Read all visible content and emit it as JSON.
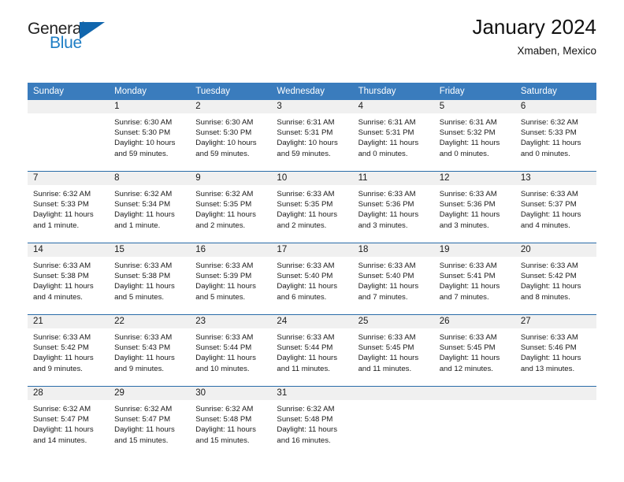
{
  "brand": {
    "name_top": "General",
    "name_bottom": "Blue",
    "accent_color": "#1166ad",
    "text_blue": "#1d7dc4"
  },
  "header": {
    "title": "January 2024",
    "subtitle": "Xmaben, Mexico"
  },
  "theme": {
    "header_bg": "#3a7cbd",
    "row_divider": "#2a6ca8",
    "daynum_bg": "#f0f0f0"
  },
  "weekday_headers": [
    "Sunday",
    "Monday",
    "Tuesday",
    "Wednesday",
    "Thursday",
    "Friday",
    "Saturday"
  ],
  "weeks": [
    [
      {
        "day": "",
        "empty": true
      },
      {
        "day": "1",
        "sunrise": "Sunrise: 6:30 AM",
        "sunset": "Sunset: 5:30 PM",
        "daylight_1": "Daylight: 10 hours",
        "daylight_2": "and 59 minutes."
      },
      {
        "day": "2",
        "sunrise": "Sunrise: 6:30 AM",
        "sunset": "Sunset: 5:30 PM",
        "daylight_1": "Daylight: 10 hours",
        "daylight_2": "and 59 minutes."
      },
      {
        "day": "3",
        "sunrise": "Sunrise: 6:31 AM",
        "sunset": "Sunset: 5:31 PM",
        "daylight_1": "Daylight: 10 hours",
        "daylight_2": "and 59 minutes."
      },
      {
        "day": "4",
        "sunrise": "Sunrise: 6:31 AM",
        "sunset": "Sunset: 5:31 PM",
        "daylight_1": "Daylight: 11 hours",
        "daylight_2": "and 0 minutes."
      },
      {
        "day": "5",
        "sunrise": "Sunrise: 6:31 AM",
        "sunset": "Sunset: 5:32 PM",
        "daylight_1": "Daylight: 11 hours",
        "daylight_2": "and 0 minutes."
      },
      {
        "day": "6",
        "sunrise": "Sunrise: 6:32 AM",
        "sunset": "Sunset: 5:33 PM",
        "daylight_1": "Daylight: 11 hours",
        "daylight_2": "and 0 minutes."
      }
    ],
    [
      {
        "day": "7",
        "sunrise": "Sunrise: 6:32 AM",
        "sunset": "Sunset: 5:33 PM",
        "daylight_1": "Daylight: 11 hours",
        "daylight_2": "and 1 minute."
      },
      {
        "day": "8",
        "sunrise": "Sunrise: 6:32 AM",
        "sunset": "Sunset: 5:34 PM",
        "daylight_1": "Daylight: 11 hours",
        "daylight_2": "and 1 minute."
      },
      {
        "day": "9",
        "sunrise": "Sunrise: 6:32 AM",
        "sunset": "Sunset: 5:35 PM",
        "daylight_1": "Daylight: 11 hours",
        "daylight_2": "and 2 minutes."
      },
      {
        "day": "10",
        "sunrise": "Sunrise: 6:33 AM",
        "sunset": "Sunset: 5:35 PM",
        "daylight_1": "Daylight: 11 hours",
        "daylight_2": "and 2 minutes."
      },
      {
        "day": "11",
        "sunrise": "Sunrise: 6:33 AM",
        "sunset": "Sunset: 5:36 PM",
        "daylight_1": "Daylight: 11 hours",
        "daylight_2": "and 3 minutes."
      },
      {
        "day": "12",
        "sunrise": "Sunrise: 6:33 AM",
        "sunset": "Sunset: 5:36 PM",
        "daylight_1": "Daylight: 11 hours",
        "daylight_2": "and 3 minutes."
      },
      {
        "day": "13",
        "sunrise": "Sunrise: 6:33 AM",
        "sunset": "Sunset: 5:37 PM",
        "daylight_1": "Daylight: 11 hours",
        "daylight_2": "and 4 minutes."
      }
    ],
    [
      {
        "day": "14",
        "sunrise": "Sunrise: 6:33 AM",
        "sunset": "Sunset: 5:38 PM",
        "daylight_1": "Daylight: 11 hours",
        "daylight_2": "and 4 minutes."
      },
      {
        "day": "15",
        "sunrise": "Sunrise: 6:33 AM",
        "sunset": "Sunset: 5:38 PM",
        "daylight_1": "Daylight: 11 hours",
        "daylight_2": "and 5 minutes."
      },
      {
        "day": "16",
        "sunrise": "Sunrise: 6:33 AM",
        "sunset": "Sunset: 5:39 PM",
        "daylight_1": "Daylight: 11 hours",
        "daylight_2": "and 5 minutes."
      },
      {
        "day": "17",
        "sunrise": "Sunrise: 6:33 AM",
        "sunset": "Sunset: 5:40 PM",
        "daylight_1": "Daylight: 11 hours",
        "daylight_2": "and 6 minutes."
      },
      {
        "day": "18",
        "sunrise": "Sunrise: 6:33 AM",
        "sunset": "Sunset: 5:40 PM",
        "daylight_1": "Daylight: 11 hours",
        "daylight_2": "and 7 minutes."
      },
      {
        "day": "19",
        "sunrise": "Sunrise: 6:33 AM",
        "sunset": "Sunset: 5:41 PM",
        "daylight_1": "Daylight: 11 hours",
        "daylight_2": "and 7 minutes."
      },
      {
        "day": "20",
        "sunrise": "Sunrise: 6:33 AM",
        "sunset": "Sunset: 5:42 PM",
        "daylight_1": "Daylight: 11 hours",
        "daylight_2": "and 8 minutes."
      }
    ],
    [
      {
        "day": "21",
        "sunrise": "Sunrise: 6:33 AM",
        "sunset": "Sunset: 5:42 PM",
        "daylight_1": "Daylight: 11 hours",
        "daylight_2": "and 9 minutes."
      },
      {
        "day": "22",
        "sunrise": "Sunrise: 6:33 AM",
        "sunset": "Sunset: 5:43 PM",
        "daylight_1": "Daylight: 11 hours",
        "daylight_2": "and 9 minutes."
      },
      {
        "day": "23",
        "sunrise": "Sunrise: 6:33 AM",
        "sunset": "Sunset: 5:44 PM",
        "daylight_1": "Daylight: 11 hours",
        "daylight_2": "and 10 minutes."
      },
      {
        "day": "24",
        "sunrise": "Sunrise: 6:33 AM",
        "sunset": "Sunset: 5:44 PM",
        "daylight_1": "Daylight: 11 hours",
        "daylight_2": "and 11 minutes."
      },
      {
        "day": "25",
        "sunrise": "Sunrise: 6:33 AM",
        "sunset": "Sunset: 5:45 PM",
        "daylight_1": "Daylight: 11 hours",
        "daylight_2": "and 11 minutes."
      },
      {
        "day": "26",
        "sunrise": "Sunrise: 6:33 AM",
        "sunset": "Sunset: 5:45 PM",
        "daylight_1": "Daylight: 11 hours",
        "daylight_2": "and 12 minutes."
      },
      {
        "day": "27",
        "sunrise": "Sunrise: 6:33 AM",
        "sunset": "Sunset: 5:46 PM",
        "daylight_1": "Daylight: 11 hours",
        "daylight_2": "and 13 minutes."
      }
    ],
    [
      {
        "day": "28",
        "sunrise": "Sunrise: 6:32 AM",
        "sunset": "Sunset: 5:47 PM",
        "daylight_1": "Daylight: 11 hours",
        "daylight_2": "and 14 minutes."
      },
      {
        "day": "29",
        "sunrise": "Sunrise: 6:32 AM",
        "sunset": "Sunset: 5:47 PM",
        "daylight_1": "Daylight: 11 hours",
        "daylight_2": "and 15 minutes."
      },
      {
        "day": "30",
        "sunrise": "Sunrise: 6:32 AM",
        "sunset": "Sunset: 5:48 PM",
        "daylight_1": "Daylight: 11 hours",
        "daylight_2": "and 15 minutes."
      },
      {
        "day": "31",
        "sunrise": "Sunrise: 6:32 AM",
        "sunset": "Sunset: 5:48 PM",
        "daylight_1": "Daylight: 11 hours",
        "daylight_2": "and 16 minutes."
      },
      {
        "day": "",
        "empty": true
      },
      {
        "day": "",
        "empty": true
      },
      {
        "day": "",
        "empty": true
      }
    ]
  ]
}
